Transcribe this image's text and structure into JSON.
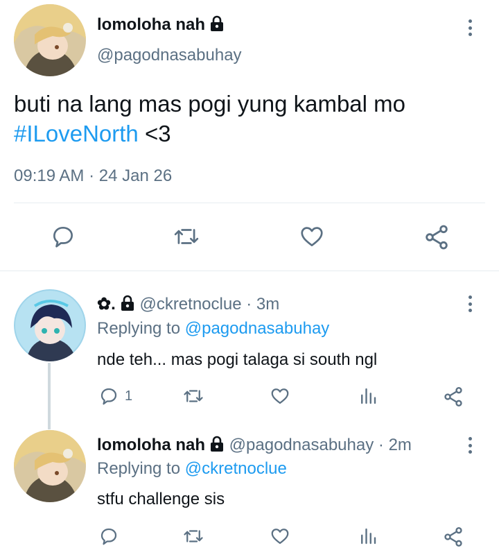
{
  "main_tweet": {
    "display_name": "lomoloha nah",
    "handle": "@pagodnasabuhay",
    "text": "buti na lang mas pogi yung kambal mo",
    "hashtag": "#ILoveNorth",
    "text_suffix": " <3",
    "time": "09:19 AM",
    "separator": "·",
    "date": "24 Jan 26"
  },
  "replies": [
    {
      "display_name": "✿.",
      "handle": "@ckretnoclue",
      "time_sep": "·",
      "time": "3m",
      "replying_prefix": "Replying to",
      "replying_to": "@pagodnasabuhay",
      "text": "nde teh... mas pogi talaga si south ngl",
      "reply_count": "1"
    },
    {
      "display_name": "lomoloha nah",
      "handle": "@pagodnasabuhay",
      "time_sep": "·",
      "time": "2m",
      "replying_prefix": "Replying to",
      "replying_to": "@ckretnoclue",
      "text": "stfu challenge sis",
      "reply_count": ""
    }
  ],
  "colors": {
    "link": "#1d9bf0",
    "muted": "#5b7083",
    "divider": "#e6ecf0"
  },
  "icons": [
    "lock-icon",
    "more-icon",
    "reply-icon",
    "retweet-icon",
    "like-icon",
    "share-icon",
    "analytics-icon"
  ]
}
